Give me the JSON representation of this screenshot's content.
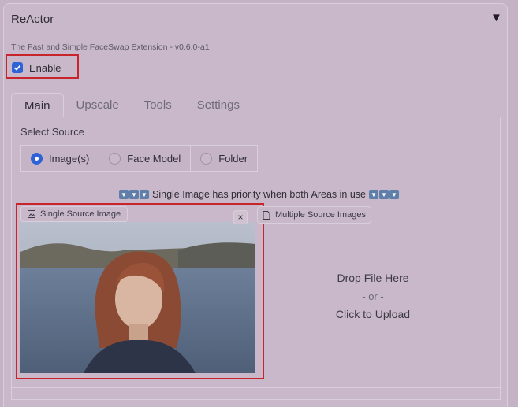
{
  "panel": {
    "title": "ReActor",
    "collapse_glyph": "▼",
    "subtitle": "The Fast and Simple FaceSwap Extension - v0.6.0-a1"
  },
  "enable": {
    "label": "Enable",
    "checked": true
  },
  "tabs": [
    {
      "label": "Main",
      "active": true
    },
    {
      "label": "Upscale",
      "active": false
    },
    {
      "label": "Tools",
      "active": false
    },
    {
      "label": "Settings",
      "active": false
    }
  ],
  "source": {
    "label": "Select Source",
    "options": [
      {
        "label": "Image(s)",
        "selected": true
      },
      {
        "label": "Face Model",
        "selected": false
      },
      {
        "label": "Folder",
        "selected": false
      }
    ]
  },
  "priority_note": "Single Image has priority when both Areas in use",
  "single_source": {
    "label": "Single Source Image",
    "close_glyph": "×"
  },
  "multiple_source": {
    "label": "Multiple Source Images",
    "drop_text": "Drop File Here",
    "or_text": "- or -",
    "upload_text": "Click to Upload"
  },
  "colors": {
    "accent": "#2f62d7",
    "highlight": "#c8242b",
    "background": "#c3b3c4"
  }
}
